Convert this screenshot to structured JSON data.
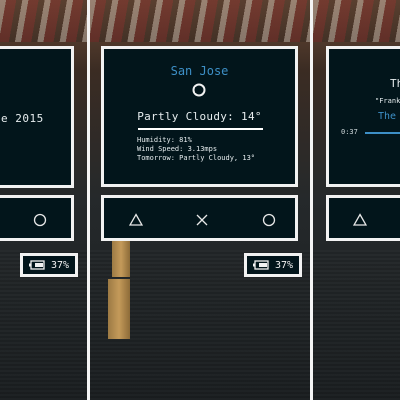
{
  "panel1": {
    "date_text": "e 2015",
    "battery": "37%"
  },
  "panel2": {
    "city": "San Jose",
    "condition": "Partly Cloudy: 14°",
    "humidity": "Humidity: 81%",
    "wind": "Wind Speed: 3.13mps",
    "tomorrow": "Tomorrow: Partly Cloudy, 13°",
    "battery": "37%"
  },
  "panel3": {
    "title": "Th",
    "artist": "\"Frank",
    "song": "The",
    "elapsed": "0:37"
  },
  "nav": {
    "icons": [
      "triangle-icon",
      "cross-icon",
      "circle-icon"
    ]
  },
  "colors": {
    "screen_bg": "#02151b",
    "border": "#f2f2f2",
    "accent": "#3d8fc6"
  }
}
